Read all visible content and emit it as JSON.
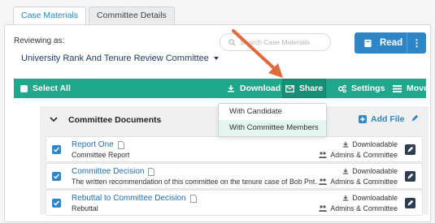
{
  "tabs": [
    {
      "label": "Case Materials",
      "active": true
    },
    {
      "label": "Committee Details",
      "active": false
    }
  ],
  "reviewing": {
    "label": "Reviewing as:",
    "committee": "University Rank And Tenure Review Committee"
  },
  "search": {
    "placeholder": "Search Case Materials"
  },
  "read_button": {
    "label": "Read",
    "more": "⋮"
  },
  "action_bar": {
    "select_all": "Select All",
    "download": "Download",
    "share": "Share",
    "settings": "Settings",
    "move": "Move"
  },
  "share_menu": {
    "options": [
      "With Candidate",
      "With Committee Members"
    ],
    "highlighted_index": 1
  },
  "section": {
    "title": "Committee Documents",
    "add_file": "Add File"
  },
  "documents": [
    {
      "name": "Report One",
      "description": "Committee Report",
      "download_status": "Downloadable",
      "access": "Admins & Committee",
      "checked": true
    },
    {
      "name": "Committee Decision",
      "description": "The written recommendation of this committee on the tenure case of Bob Pnt.",
      "download_status": "Downloadable",
      "access": "Admins & Committee",
      "checked": true
    },
    {
      "name": "Rebuttal to Committee Decision",
      "description": "Rebuttal",
      "download_status": "Downloadable",
      "access": "Admins & Committee",
      "checked": true
    }
  ],
  "colors": {
    "action_bar": "#21a88c",
    "primary_blue": "#2f86c6",
    "annotation_arrow": "#e06a3b"
  }
}
